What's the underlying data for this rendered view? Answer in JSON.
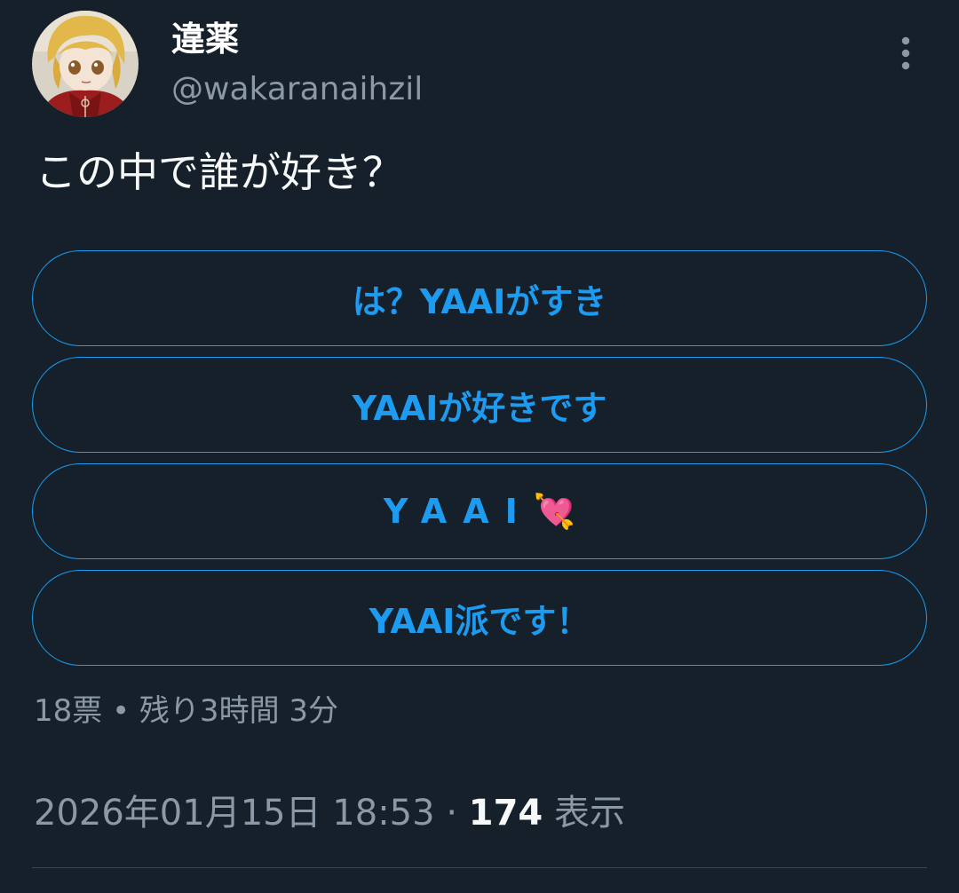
{
  "author": {
    "display_name": "違薬",
    "handle": "@wakaranaihzil"
  },
  "tweet": {
    "text": "この中で誰が好き？"
  },
  "poll": {
    "options": [
      {
        "label": "は？YAAIがすき"
      },
      {
        "label": "YAAIが好きです"
      },
      {
        "label": "YAAI",
        "emoji": "💘"
      },
      {
        "label": "YAAI派です！"
      }
    ],
    "meta": "18票 • 残り3時間 3分"
  },
  "footer": {
    "timestamp": "2026年01月15日 18:53",
    "separator": "·",
    "views_count": "174",
    "views_label": "表示"
  },
  "icons": {
    "more": "more-vertical-icon",
    "emoji": "heart-with-arrow-icon"
  },
  "colors": {
    "background": "#15202b",
    "accent": "#1d9bf0",
    "secondary_text": "#8b98a5",
    "primary_text": "#f7f9f9"
  }
}
